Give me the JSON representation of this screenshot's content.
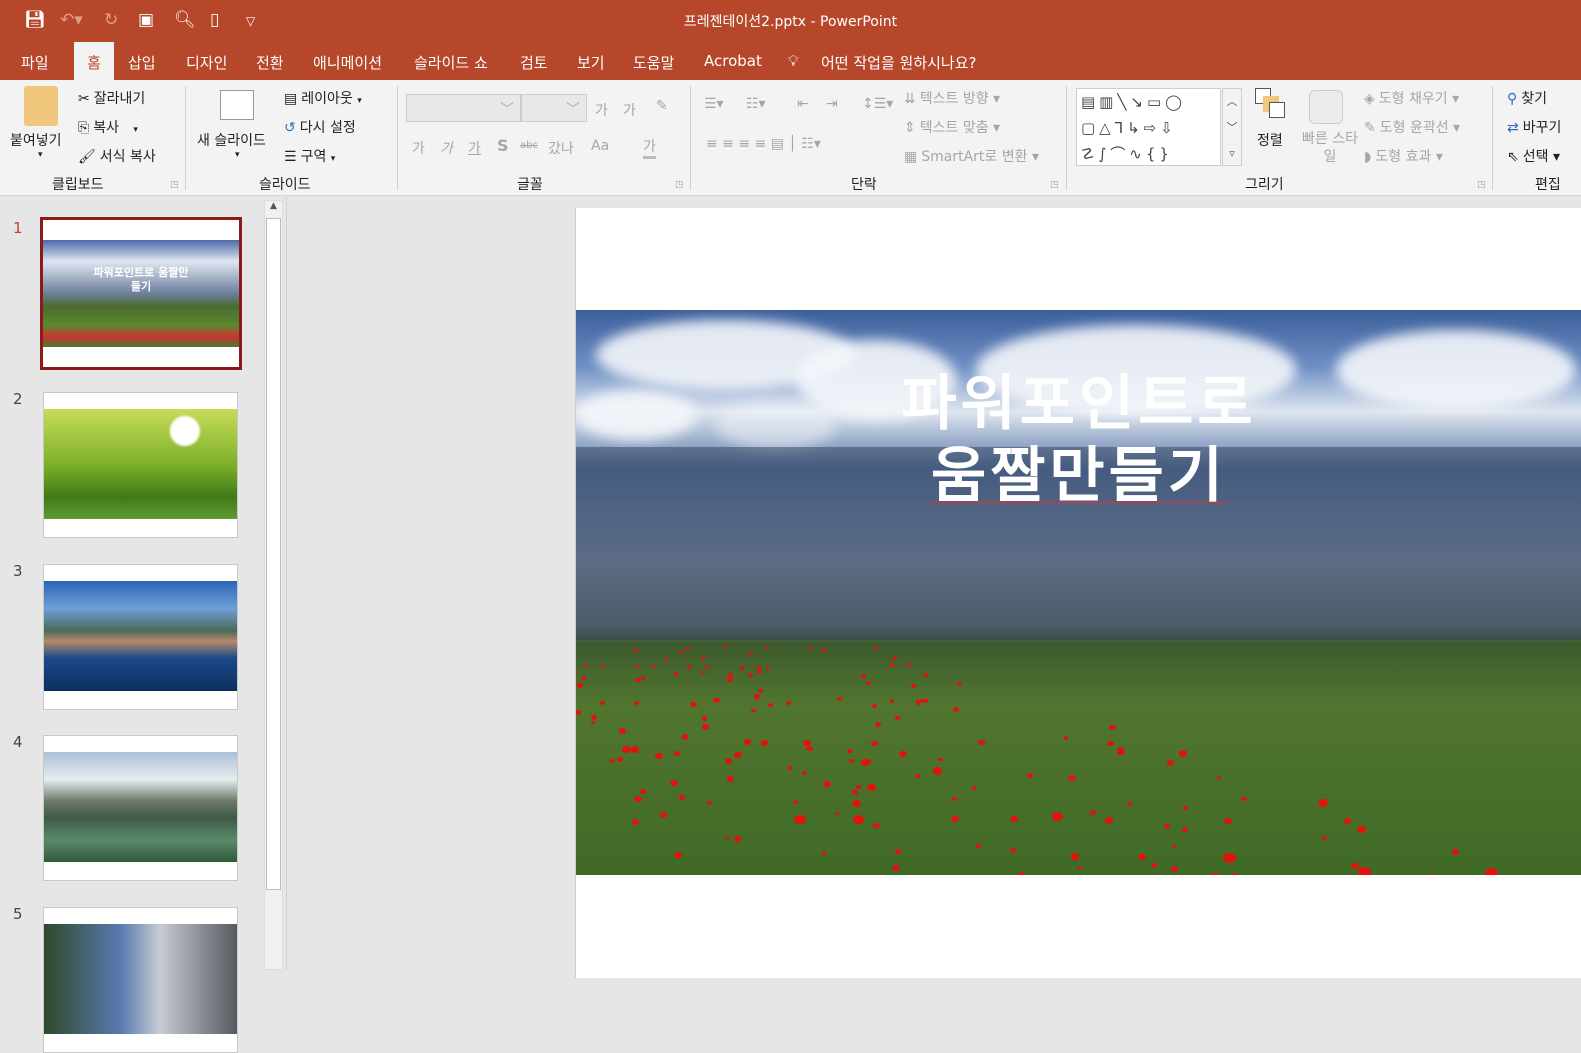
{
  "titlebar": {
    "title": "프레젠테이션2.pptx  -  PowerPoint",
    "quick_access": [
      "save-icon",
      "undo-icon",
      "redo-icon",
      "start-from-beginning-icon",
      "print-preview-icon",
      "new-file-icon",
      "customize-icon"
    ]
  },
  "tabs": [
    "파일",
    "홈",
    "삽입",
    "디자인",
    "전환",
    "애니메이션",
    "슬라이드 쇼",
    "검토",
    "보기",
    "도움말",
    "Acrobat"
  ],
  "tell_me": "어떤 작업을 원하시나요?",
  "ribbon": {
    "clipboard": {
      "paste": "붙여넣기",
      "cut": "잘라내기",
      "copy": "복사",
      "format_painter": "서식 복사",
      "label": "클립보드"
    },
    "slides": {
      "new_slide": "새 슬라이드",
      "layout": "레이아웃",
      "reset": "다시 설정",
      "section": "구역",
      "label": "슬라이드"
    },
    "font": {
      "label": "글꼴",
      "buttons": [
        "가",
        "가",
        "가",
        "S",
        "abc",
        "갔나",
        "Aa",
        "가"
      ],
      "grow": "가",
      "shrink": "가"
    },
    "paragraph": {
      "text_direction": "텍스트 방향",
      "align_text": "텍스트 맞춤",
      "smartart": "SmartArt로 변환",
      "label": "단락"
    },
    "drawing": {
      "arrange": "정렬",
      "quick_styles": "빠른 스타일",
      "shape_fill": "도형 채우기",
      "shape_outline": "도형 윤곽선",
      "shape_effects": "도형 효과",
      "label": "그리기"
    },
    "editing": {
      "find": "찾기",
      "replace": "바꾸기",
      "select": "선택",
      "label": "편집"
    }
  },
  "thumbnails": [
    {
      "num": "1",
      "title": "파워포인트로 움짤만들기"
    },
    {
      "num": "2"
    },
    {
      "num": "3"
    },
    {
      "num": "4"
    },
    {
      "num": "5"
    }
  ],
  "slide": {
    "title_line1": "파워포인트로",
    "title_line2": "움짤만들기"
  },
  "colors": {
    "accent": "#b7472a",
    "selected": "#8b1a1a"
  }
}
